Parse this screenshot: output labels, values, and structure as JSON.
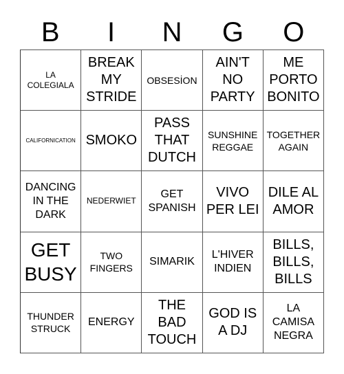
{
  "header": {
    "letters": [
      "B",
      "I",
      "N",
      "G",
      "O"
    ]
  },
  "rows": [
    [
      "LA COLEGIALA",
      "BREAK MY STRIDE",
      "OBSESİON",
      "AIN'T NO PARTY",
      "ME PORTO BONITO"
    ],
    [
      "CALIFORNICATION",
      "SMOKO",
      "PASS THAT DUTCH",
      "SUNSHINE REGGAE",
      "TOGETHER AGAIN"
    ],
    [
      "DANCING IN THE DARK",
      "NEDERWIET",
      "GET SPANISH",
      "VIVO PER LEI",
      "DILE AL AMOR"
    ],
    [
      "GET BUSY",
      "TWO FINGERS",
      "SIMARIK",
      "L'HIVER INDIEN",
      "BILLS, BILLS, BILLS"
    ],
    [
      "THUNDER STRUCK",
      "ENERGY",
      "THE BAD TOUCH",
      "GOD IS A DJ",
      "LA CAMISA NEGRA"
    ]
  ]
}
